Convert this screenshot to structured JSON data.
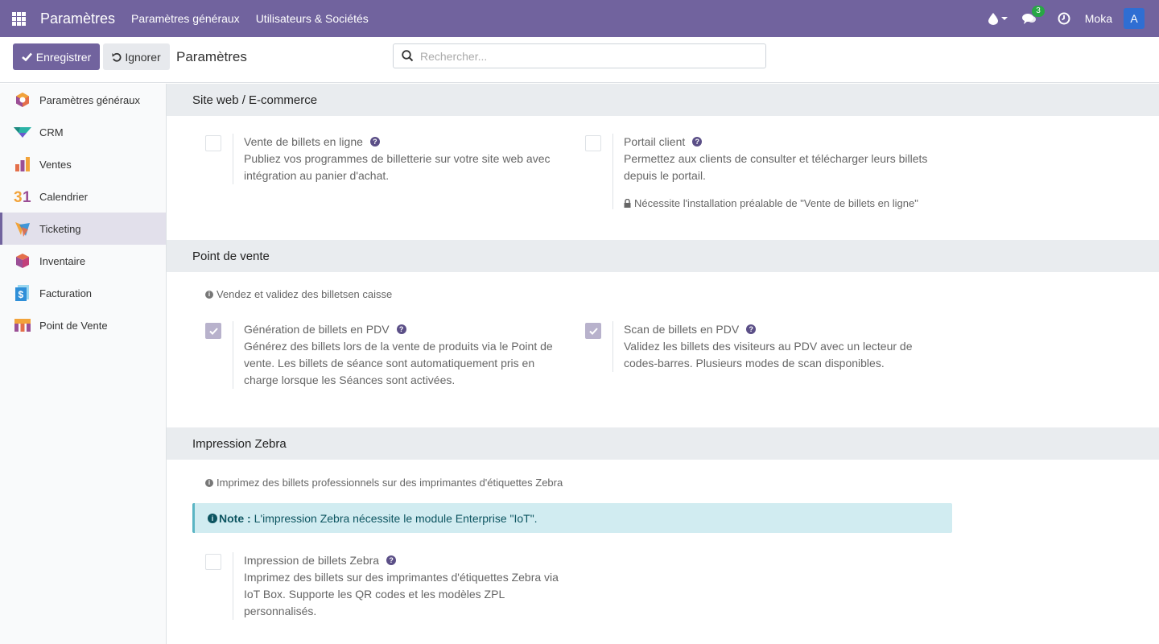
{
  "navbar": {
    "app_title": "Paramètres",
    "menu": [
      "Paramètres généraux",
      "Utilisateurs & Sociétés"
    ],
    "message_count": "3",
    "user_name": "Moka",
    "avatar_letter": "A",
    "color": "#71639e"
  },
  "control_panel": {
    "save_label": "Enregistrer",
    "discard_label": "Ignorer",
    "title": "Paramètres",
    "search_placeholder": "Rechercher..."
  },
  "sidebar": {
    "items": [
      {
        "label": "Paramètres généraux",
        "icon": "settings-hexagon-icon",
        "active": false
      },
      {
        "label": "CRM",
        "icon": "crm-icon",
        "active": false
      },
      {
        "label": "Ventes",
        "icon": "sales-chart-icon",
        "active": false
      },
      {
        "label": "Calendrier",
        "icon": "calendar-icon",
        "active": false
      },
      {
        "label": "Ticketing",
        "icon": "ticketing-icon",
        "active": true
      },
      {
        "label": "Inventaire",
        "icon": "inventory-cube-icon",
        "active": false
      },
      {
        "label": "Facturation",
        "icon": "invoicing-icon",
        "active": false
      },
      {
        "label": "Point de Vente",
        "icon": "pos-store-icon",
        "active": false
      }
    ]
  },
  "sections": {
    "website": {
      "title": "Site web / E-commerce",
      "online_ticketing": {
        "title": "Vente de billets en ligne",
        "desc1": "Publiez vos programmes de billetterie sur votre site web avec",
        "desc2": "intégration au panier d'achat.",
        "checked": false
      },
      "customer_portal": {
        "title": "Portail client",
        "desc1": "Permettez aux clients de consulter et télécharger leurs billets",
        "desc2": "depuis le portail.",
        "note": "Nécessite l'installation préalable de \"Vente de billets en ligne\"",
        "checked": false
      }
    },
    "pos": {
      "title": "Point de vente",
      "info": "Vendez et validez des billetsen caisse",
      "generation": {
        "title": "Génération de billets en PDV",
        "desc1": "Générez des billets lors de la vente de produits via le Point de",
        "desc2": "vente. Les billets de séance sont automatiquement pris en",
        "desc3": "charge lorsque les Séances sont activées.",
        "checked": true
      },
      "scan": {
        "title": "Scan de billets en PDV",
        "desc1": "Validez les billets des visiteurs au PDV avec un lecteur de",
        "desc2": "codes-barres. Plusieurs modes de scan disponibles.",
        "checked": true
      }
    },
    "zebra": {
      "title": "Impression Zebra",
      "info": "Imprimez des billets professionnels sur des imprimantes d'étiquettes Zebra",
      "alert_label": "Note :",
      "alert_text": "L'impression Zebra nécessite le module Enterprise \"IoT\".",
      "printing": {
        "title": "Impression de billets Zebra",
        "desc1": "Imprimez des billets sur des imprimantes d'étiquettes Zebra via",
        "desc2": "IoT Box. Supporte les QR codes et les modèles ZPL",
        "desc3": "personnalisés.",
        "checked": false
      }
    }
  }
}
